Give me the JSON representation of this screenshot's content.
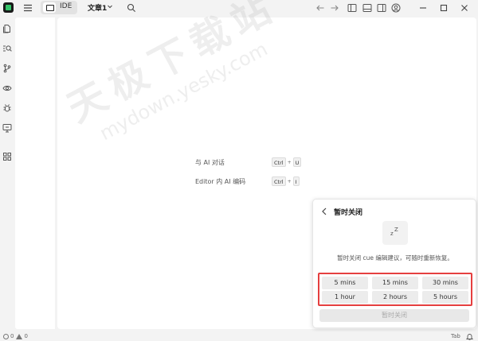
{
  "titlebar": {
    "mode_label": "IDE",
    "doc_title": "文章1",
    "icons": [
      "app-logo",
      "menu-icon",
      "keyboard-icon",
      "chevron-down-icon",
      "search-icon",
      "arrow-left-icon",
      "arrow-right-icon",
      "layout-left-icon",
      "layout-bottom-icon",
      "layout-right-icon",
      "account-icon",
      "minimize-icon",
      "maximize-icon",
      "close-icon"
    ]
  },
  "activity_bar": {
    "icons": [
      "files-icon",
      "search-list-icon",
      "source-control-icon",
      "eye-icon",
      "bug-icon",
      "remote-monitor-icon",
      "extensions-grid-icon"
    ]
  },
  "editor": {
    "hints": [
      {
        "label": "与 AI 对话",
        "keys": [
          "Ctrl",
          "U"
        ]
      },
      {
        "label": "Editor 内 AI 编码",
        "keys": [
          "Ctrl",
          "I"
        ]
      }
    ],
    "plus": "+"
  },
  "watermark": {
    "line1": "天极下载站",
    "line2": "mydown.yesky.com"
  },
  "popup": {
    "title": "暂时关闭",
    "zz_small": "z",
    "zz_large": "Z",
    "description": "暂时关闭 cue 编辑建议，可随时重新恢复。",
    "options": [
      "5 mins",
      "15 mins",
      "30 mins",
      "1 hour",
      "2 hours",
      "5 hours"
    ],
    "disable_button": "暂时关闭",
    "highlight_color": "#e53f3f"
  },
  "statusbar": {
    "errors": "0",
    "warnings": "0",
    "tab_label": "Tab"
  }
}
